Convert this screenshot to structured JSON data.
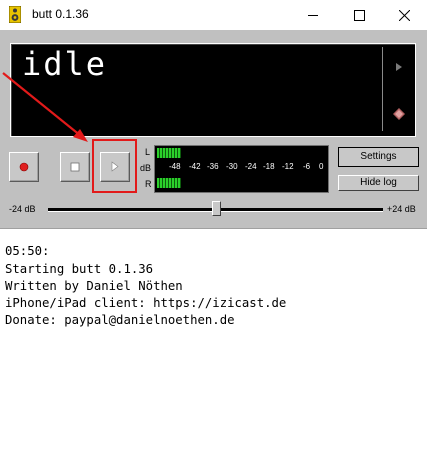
{
  "window": {
    "title": "butt 0.1.36",
    "icons": {
      "app": "speaker-icon",
      "minimize": "minimize-icon",
      "maximize": "maximize-icon",
      "close": "close-icon"
    }
  },
  "display": {
    "status_text": "idle"
  },
  "controls": {
    "record_icon": "record-icon",
    "stop_icon": "stop-icon",
    "play_icon": "play-icon"
  },
  "vu_meter": {
    "left_label": "L",
    "db_label": "dB",
    "right_label": "R",
    "scale": [
      "-48",
      "-42",
      "-36",
      "-30",
      "-24",
      "-18",
      "-12",
      "-6",
      "0"
    ]
  },
  "buttons": {
    "settings": "Settings",
    "hide_log": "Hide log"
  },
  "gain_slider": {
    "min_label": "-24 dB",
    "max_label": "+24 dB"
  },
  "log": {
    "lines": [
      "05:50:",
      "Starting butt 0.1.36",
      "Written by Daniel Nöthen",
      "iPhone/iPad client: https://izicast.de",
      "Donate: paypal@danielnoethen.de"
    ]
  },
  "colors": {
    "annotation_red": "#e21a1a",
    "vu_green": "#2bd12b",
    "record_red": "#e02020"
  }
}
